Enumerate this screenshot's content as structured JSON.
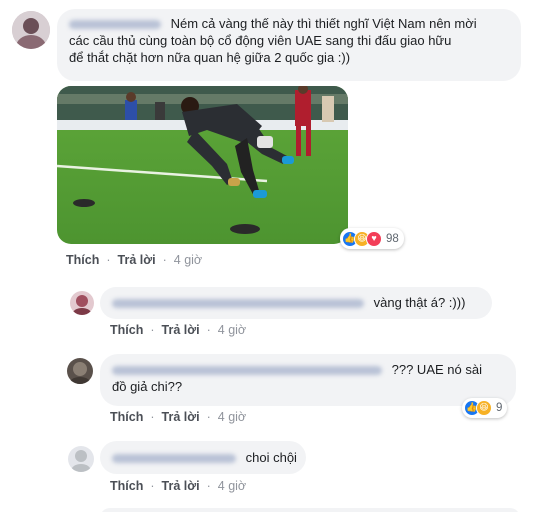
{
  "colors": {
    "link": "#4b4f56",
    "bubble": "#f2f3f5",
    "like": "#1877f2",
    "haha": "#f7b125",
    "love": "#f33e58"
  },
  "main_comment": {
    "text": "Ném cả vàng thế này thì thiết nghĩ Việt Nam nên mời các cầu thủ cùng toàn bộ cổ động viên UAE sang thi đấu giao hữu để thắt chặt hơn nữa quan hệ giữa 2 quốc gia :))",
    "line1": "Ném cả vàng thế này thì thiết nghĩ Việt Nam nên mời",
    "line2": "các cầu thủ cùng toàn bộ cổ động viên UAE sang thi đấu giao hữu",
    "line3": "để thắt chặt hơn nữa quan hệ giữa 2 quốc gia :))",
    "image_icon": "soccer-photo",
    "like_label": "Thích",
    "reply_label": "Trả lời",
    "time": "4 giờ",
    "reactions": {
      "icons": [
        "like-icon",
        "haha-icon",
        "love-icon"
      ],
      "count": "98"
    }
  },
  "replies": [
    {
      "text": "vàng thật á? :)))",
      "like_label": "Thích",
      "reply_label": "Trả lời",
      "time": "4 giờ"
    },
    {
      "text_line1": "??? UAE nó sài",
      "text_line2": "đồ giả chi??",
      "like_label": "Thích",
      "reply_label": "Trả lời",
      "time": "4 giờ",
      "reactions": {
        "icons": [
          "like-icon",
          "haha-icon"
        ],
        "count": "9"
      }
    },
    {
      "text": "choi chội",
      "like_label": "Thích",
      "reply_label": "Trả lời",
      "time": "4 giờ"
    }
  ]
}
